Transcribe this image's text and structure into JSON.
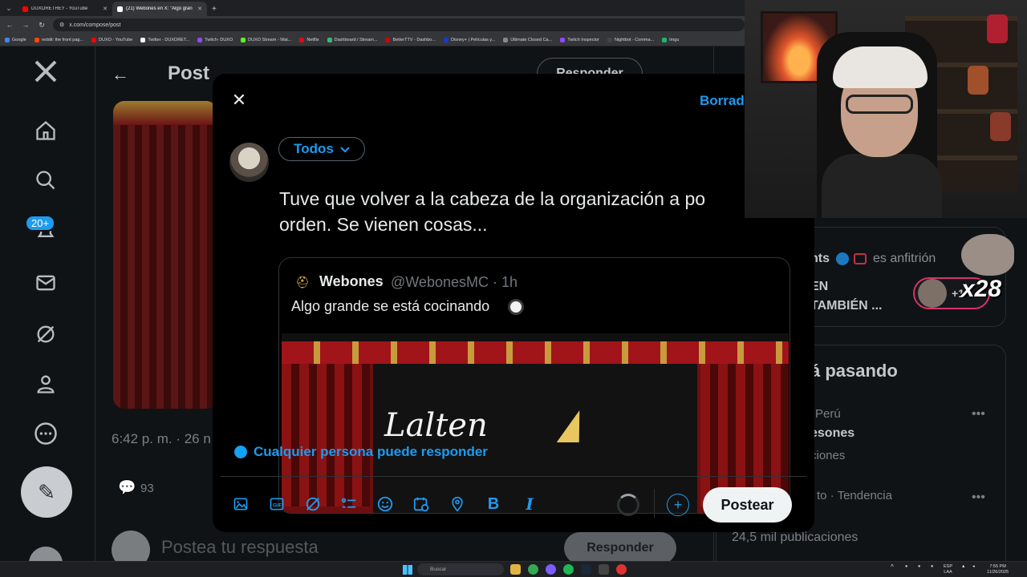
{
  "browser": {
    "tabs": [
      {
        "title": "DUXORETHEY - YouTube",
        "color": "#ff0000",
        "active": false
      },
      {
        "title": "(21) Webones en X: \"Algo gran",
        "color": "#ffffff",
        "active": true
      }
    ],
    "url": "x.com/compose/post",
    "bookmarks": [
      {
        "label": "Google",
        "color": "#4285f4"
      },
      {
        "label": "reddit: the front pag...",
        "color": "#ff4500"
      },
      {
        "label": "DUXO - YouTube",
        "color": "#ff0000"
      },
      {
        "label": "Twitter - DUXORET...",
        "color": "#ffffff"
      },
      {
        "label": "Twitch- DUXO",
        "color": "#9146ff"
      },
      {
        "label": "DUXO Stream - Wat...",
        "color": "#53fc18"
      },
      {
        "label": "Netflix",
        "color": "#e50914"
      },
      {
        "label": "Dashboard / Stream...",
        "color": "#3ab77d"
      },
      {
        "label": "BetterTTV - Dashbo...",
        "color": "#d50000"
      },
      {
        "label": "Disney+ | Películas y...",
        "color": "#113ccf"
      },
      {
        "label": "Ultimate Closed Ca...",
        "color": "#888888"
      },
      {
        "label": "Twitch Inspector",
        "color": "#9146ff"
      },
      {
        "label": "Nightbot - Comma...",
        "color": "#444444"
      },
      {
        "label": "Imgu",
        "color": "#1bb76e"
      }
    ]
  },
  "sidebar": {
    "notifications_badge": "20+"
  },
  "post_page": {
    "heading": "Post",
    "header_button": "Responder",
    "timestamp": "6:42 p. m. · 26 n",
    "reply_count": "93",
    "reply_placeholder": "Postea tu respuesta",
    "reply_button": "Responder"
  },
  "right_column": {
    "host_name": "nts",
    "host_label": "es anfitrión",
    "space_title_line1": "EN",
    "space_title_line2": "TAMBIÉN ...",
    "listener_count": "+1",
    "trends_heading": "á pasando",
    "trends": [
      {
        "meta": "Perú",
        "name": "esones",
        "sub": "ciones"
      },
      {
        "meta": "to · Tendencia",
        "name": "",
        "sub": ""
      }
    ],
    "last_count": "24,5 mil publicaciones"
  },
  "compose": {
    "drafts_label": "Borrad",
    "audience": "Todos",
    "text_line1": "Tuve que volver a la cabeza de la organización a po",
    "text_line2": "orden. Se vienen cosas...",
    "quote": {
      "name": "Webones",
      "handle": "@WebonesMC · 1h",
      "text": "Algo grande se está cocinando",
      "media_script": "Lalten"
    },
    "reply_setting": "Cualquier persona puede responder",
    "post_button": "Postear",
    "tools": [
      "image-icon",
      "gif-icon",
      "grok-icon",
      "poll-icon",
      "emoji-icon",
      "schedule-icon",
      "location-icon",
      "bold-icon",
      "italic-icon"
    ]
  },
  "overlay": {
    "multiplier": "x28"
  },
  "taskbar": {
    "search_placeholder": "Buscar",
    "lang": "ESP",
    "lang_sub": "LAA",
    "time": "7:55 PM",
    "date": "11/26/2025"
  }
}
